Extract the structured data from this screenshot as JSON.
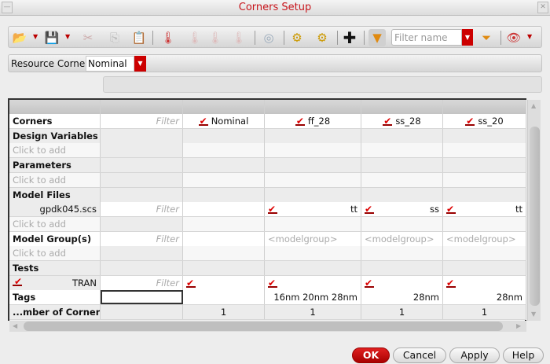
{
  "window": {
    "title": "Corners Setup"
  },
  "toolbar": {
    "filter_placeholder": "Filter name"
  },
  "resource_corner": {
    "label": "Resource Corner",
    "value": "Nominal"
  },
  "grid": {
    "filter_placeholder": "Filter",
    "corners": [
      "Nominal",
      "ff_28",
      "ss_28",
      "ss_20"
    ],
    "rows": [
      {
        "label": "Corners",
        "type": "corners"
      },
      {
        "label": "Design Variables",
        "type": "section"
      },
      {
        "label": "Click to add",
        "type": "add"
      },
      {
        "label": "Parameters",
        "type": "section"
      },
      {
        "label": "Click to add",
        "type": "add"
      },
      {
        "label": "Model Files",
        "type": "section"
      },
      {
        "label": "gpdk045.scs",
        "type": "model",
        "values": [
          "",
          "tt",
          "ss",
          "tt"
        ],
        "checked": [
          false,
          true,
          true,
          true
        ]
      },
      {
        "label": "Click to add",
        "type": "add"
      },
      {
        "label": "Model Group(s)",
        "type": "modelgroup",
        "values": [
          "",
          "<modelgroup>",
          "<modelgroup>",
          "<modelgroup>"
        ]
      },
      {
        "label": "Click to add",
        "type": "add"
      },
      {
        "label": "Tests",
        "type": "section"
      },
      {
        "label": "TRAN",
        "type": "test",
        "checked": [
          true,
          true,
          true,
          true
        ]
      },
      {
        "label": "Tags",
        "type": "tags",
        "values": [
          "",
          "16nm 20nm 28nm",
          "28nm",
          "28nm"
        ]
      },
      {
        "label": "...mber of Corners",
        "type": "count",
        "values": [
          "1",
          "1",
          "1",
          "1"
        ]
      }
    ]
  },
  "buttons": {
    "ok": "OK",
    "cancel": "Cancel",
    "apply": "Apply",
    "help": "Help"
  }
}
